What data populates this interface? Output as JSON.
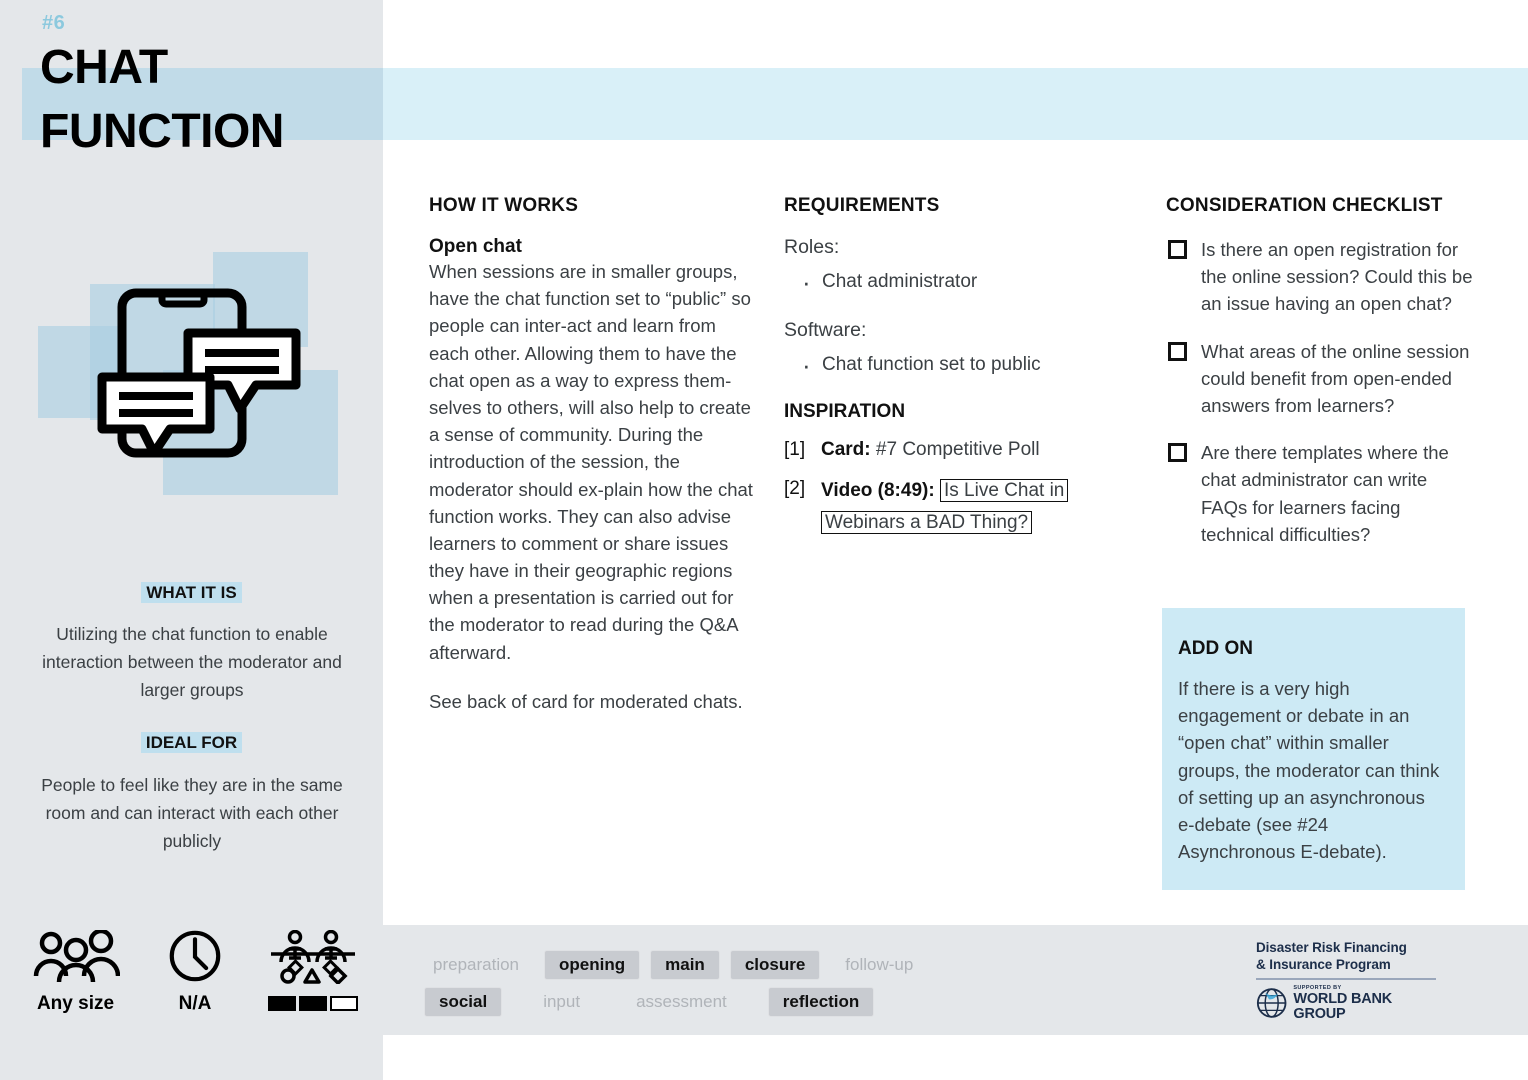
{
  "card": {
    "number": "#6",
    "title_line1": "CHAT",
    "title_line2": "FUNCTION"
  },
  "sidebar": {
    "what_it_is_heading": "WHAT IT IS",
    "what_it_is_body": "Utilizing the chat function to enable interaction between the moderator and larger groups",
    "ideal_for_heading": "IDEAL FOR",
    "ideal_for_body": "People to feel like they are in the same room and can interact with each other publicly",
    "meta": {
      "group_size_label": "Any size",
      "duration_label": "N/A",
      "complexity_filled": 2,
      "complexity_total": 3
    }
  },
  "how_it_works": {
    "title": "HOW IT WORKS",
    "subtitle": "Open chat",
    "body": "When sessions are in smaller groups, have the chat function set to “public” so people can inter-act and learn from each other. Allowing them to have the chat open as a way to express them-selves to others, will also help to create a sense of community. During the introduction of the session, the moderator should ex-plain how the chat function works. They can also advise learners to comment or share issues they have in their geographic regions when a presentation is carried out for the moderator to read during the Q&A afterward.",
    "note": "See back of card for moderated chats."
  },
  "requirements": {
    "title": "REQUIREMENTS",
    "roles_label": "Roles:",
    "roles": [
      "Chat administrator"
    ],
    "software_label": "Software:",
    "software": [
      "Chat function set to public"
    ]
  },
  "inspiration": {
    "title": "INSPIRATION",
    "items": [
      {
        "tag": "[1]",
        "label": "Card:",
        "text": "#7 Competitive Poll",
        "boxed": ""
      },
      {
        "tag": "[2]",
        "label": "Video (8:49):",
        "text": "",
        "boxed": "Is Live Chat in Webinars a BAD Thing?"
      }
    ]
  },
  "checklist": {
    "title": "CONSIDERATION CHECKLIST",
    "items": [
      "Is there an open registration for the online session? Could this be an issue having an open chat?",
      "What areas of the online session could benefit from open-ended answers from learners?",
      "Are there templates where the chat administrator can write FAQs for learners facing technical difficulties?"
    ]
  },
  "add_on": {
    "title": "ADD ON",
    "body": "If there is a very high engagement or debate in an “open chat” within smaller groups, the moderator can think of setting up an asynchronous e-debate (see #24 Asynchronous E-debate)."
  },
  "footer": {
    "tags_row1": [
      {
        "label": "preparation",
        "active": false
      },
      {
        "label": "opening",
        "active": true
      },
      {
        "label": "main",
        "active": true
      },
      {
        "label": "closure",
        "active": true
      },
      {
        "label": "follow-up",
        "active": false
      }
    ],
    "tags_row2": [
      {
        "label": "social",
        "active": true
      },
      {
        "label": "input",
        "active": false
      },
      {
        "label": "assessment",
        "active": false
      },
      {
        "label": "reflection",
        "active": true
      }
    ],
    "logo": {
      "line1": "Disaster Risk Financing",
      "line2": "& Insurance Program",
      "supported_by": "SUPPORTED BY",
      "world_bank": "WORLD BANK GROUP"
    }
  },
  "colors": {
    "sidebar_bg": "#e4e7ea",
    "header_band": "#d9f0f8",
    "header_band_sidebar": "#c1dbe8",
    "accent_blue": "#8cc9de",
    "highlight": "#bfdfee",
    "addon_bg": "#cdeaf5",
    "tag_bg": "#c8cbd0",
    "logo_navy": "#1c2e4a"
  }
}
